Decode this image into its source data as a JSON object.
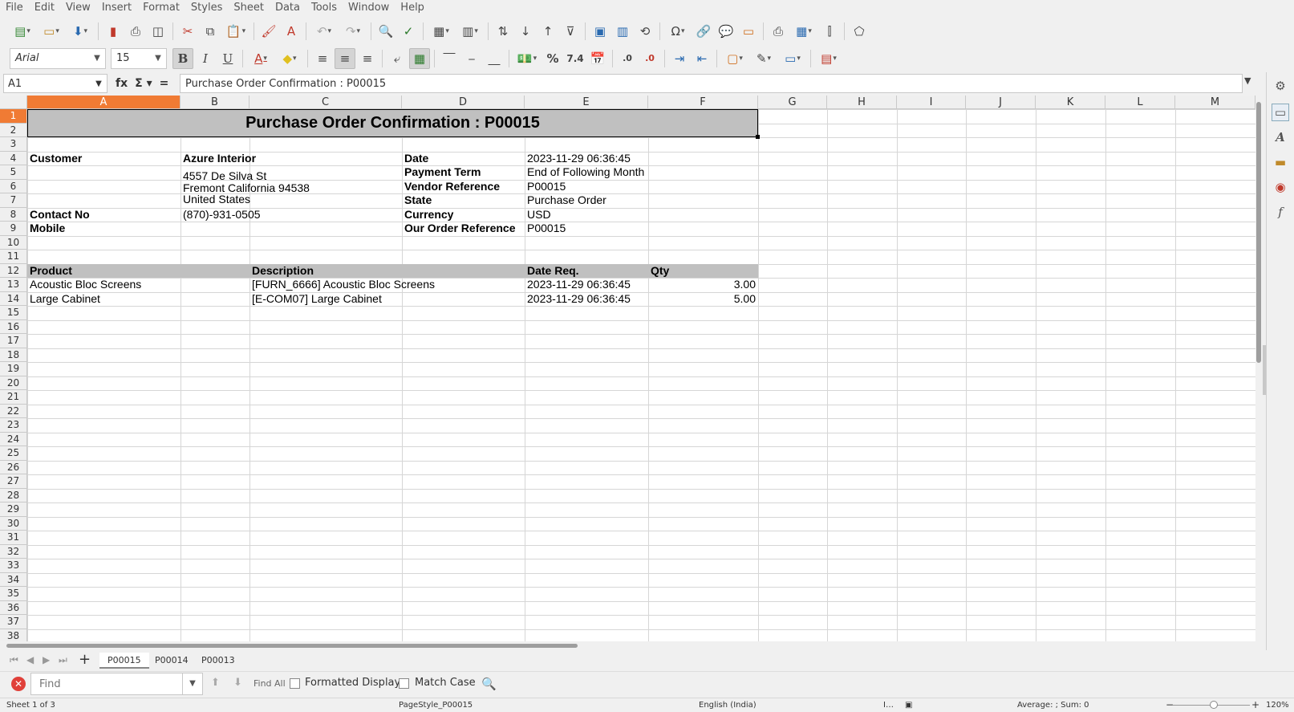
{
  "menu": [
    "File",
    "Edit",
    "View",
    "Insert",
    "Format",
    "Styles",
    "Sheet",
    "Data",
    "Tools",
    "Window",
    "Help"
  ],
  "font": {
    "name": "Arial",
    "size": "15"
  },
  "namebox": "A1",
  "formula": "Purchase Order Confirmation : P00015",
  "columns": [
    "A",
    "B",
    "C",
    "D",
    "E",
    "F",
    "G",
    "H",
    "I",
    "J",
    "K",
    "L",
    "M"
  ],
  "rows": [
    "1",
    "2",
    "3",
    "4",
    "5",
    "6",
    "7",
    "8",
    "9",
    "10",
    "11",
    "12",
    "13",
    "14",
    "15",
    "16",
    "17",
    "18",
    "19",
    "20",
    "21",
    "22",
    "23",
    "24",
    "25",
    "26",
    "27",
    "28",
    "29",
    "30",
    "31",
    "32",
    "33",
    "34",
    "35",
    "36",
    "37",
    "38"
  ],
  "sheet": {
    "title": "Purchase Order Confirmation : P00015",
    "customer_label": "Customer",
    "customer_name": "Azure Interior",
    "address1": "4557 De Silva St",
    "address2": "Fremont California 94538",
    "address3": "United States",
    "contact_label": "Contact No",
    "contact_value": "(870)-931-0505",
    "mobile_label": "Mobile",
    "date_label": "Date",
    "date_value": "2023-11-29 06:36:45",
    "payterm_label": "Payment Term",
    "payterm_value": "End of Following Month",
    "vendorref_label": "Vendor Reference",
    "vendorref_value": "P00015",
    "state_label": "State",
    "state_value": "Purchase Order",
    "currency_label": "Currency",
    "currency_value": "USD",
    "orderref_label": "Our Order Reference",
    "orderref_value": "P00015",
    "headers": {
      "product": "Product",
      "description": "Description",
      "date_req": "Date Req.",
      "qty": "Qty"
    },
    "lines": [
      {
        "product": "Acoustic Bloc Screens",
        "description": "[FURN_6666] Acoustic Bloc Screens",
        "date_req": "2023-11-29 06:36:45",
        "qty": "3.00"
      },
      {
        "product": "Large Cabinet",
        "description": "[E-COM07] Large Cabinet",
        "date_req": "2023-11-29 06:36:45",
        "qty": "5.00"
      }
    ]
  },
  "tabs": [
    "P00015",
    "P00014",
    "P00013"
  ],
  "find": {
    "placeholder": "Find",
    "find_all": "Find All",
    "formatted_display": "Formatted Display",
    "match_case": "Match Case"
  },
  "status": {
    "sheet": "Sheet 1 of 3",
    "pagestyle": "PageStyle_P00015",
    "language": "English (India)",
    "summary": "Average: ; Sum: 0",
    "zoom": "120%"
  },
  "icons": {
    "sidebar": [
      "gear-icon",
      "properties-icon",
      "styles-icon",
      "gallery-icon",
      "navigator-icon",
      "functions-icon"
    ]
  }
}
